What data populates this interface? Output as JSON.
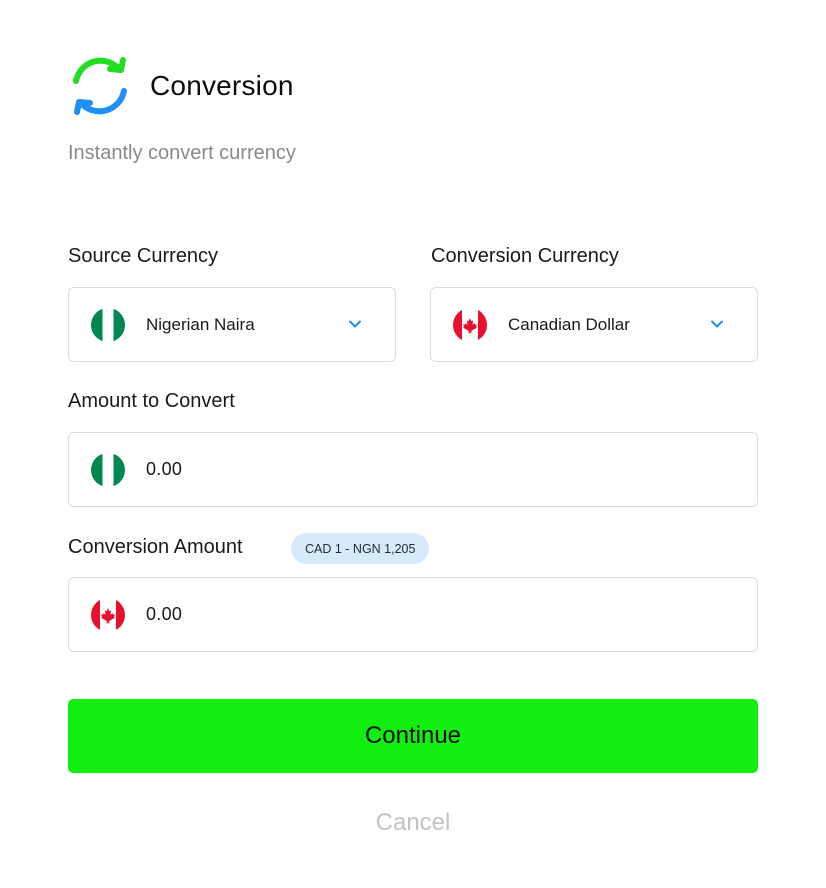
{
  "header": {
    "title": "Conversion",
    "subtitle": "Instantly convert currency",
    "logo_icon": "refresh-icon",
    "logo_colors": {
      "top": "#22dd22",
      "bottom": "#1e90f5"
    }
  },
  "source_currency": {
    "label": "Source Currency",
    "selected": "Nigerian Naira",
    "flag_icon": "nigeria-flag-icon"
  },
  "conversion_currency": {
    "label": "Conversion Currency",
    "selected": "Canadian Dollar",
    "flag_icon": "canada-flag-icon"
  },
  "amount_to_convert": {
    "label": "Amount to Convert",
    "value": "0.00"
  },
  "conversion_amount": {
    "label": "Conversion Amount",
    "rate_badge": "CAD 1 - NGN 1,205",
    "value": "0.00"
  },
  "actions": {
    "continue_label": "Continue",
    "cancel_label": "Cancel"
  },
  "colors": {
    "accent": "#11ef11",
    "chevron": "#1e90f5",
    "badge_bg": "#d6eafb",
    "muted": "#8a8a8a",
    "nigeria_green": "#008751",
    "canada_red": "#e8112d"
  }
}
